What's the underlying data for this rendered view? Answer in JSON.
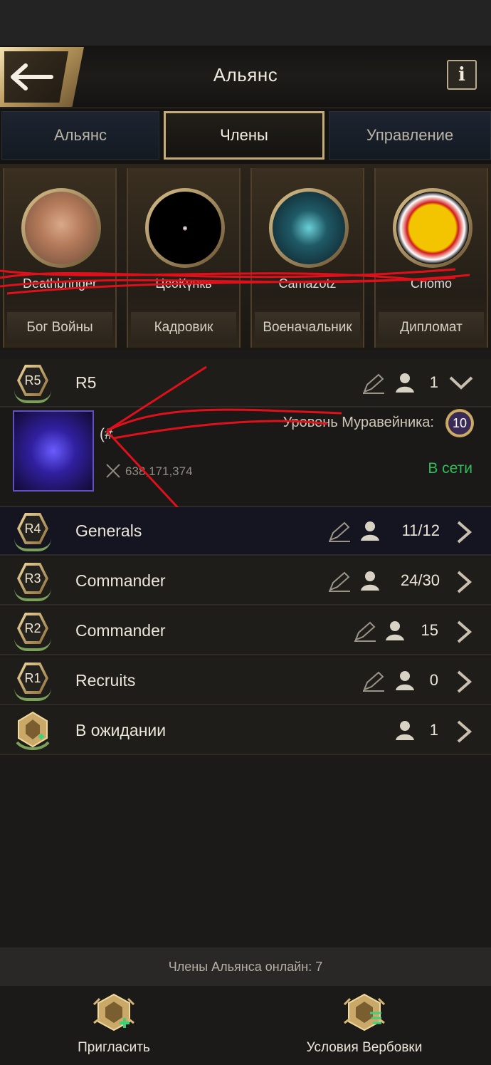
{
  "header": {
    "title": "Альянс"
  },
  "tabs": [
    {
      "label": "Альянс",
      "active": false
    },
    {
      "label": "Члены",
      "active": true
    },
    {
      "label": "Управление",
      "active": false
    }
  ],
  "leaders": [
    {
      "name": "Deathbringer",
      "role": "Бог Войны"
    },
    {
      "name": "ЦсоКүнкь",
      "role": "Кадровик"
    },
    {
      "name": "Camazotz",
      "role": "Военачальник"
    },
    {
      "name": "Chomo",
      "role": "Дипломат"
    }
  ],
  "ranks": [
    {
      "badge": "R5",
      "label": "R5",
      "count": "1",
      "expanded": true
    },
    {
      "badge": "R4",
      "label": "Generals",
      "count": "11/12"
    },
    {
      "badge": "R3",
      "label": "Commander",
      "count": "24/30"
    },
    {
      "badge": "R2",
      "label": "Commander",
      "count": "15"
    },
    {
      "badge": "R1",
      "label": "Recruits",
      "count": "0"
    },
    {
      "badge": "",
      "label": "В ожидании",
      "count": "1"
    }
  ],
  "member": {
    "name": "(#",
    "power": "638,171,374",
    "level_label": "Уровень Муравейника:",
    "level": "10",
    "status": "В сети"
  },
  "footer": {
    "online_text": "Члены Альянса онлайн: 7",
    "invite_label": "Пригласить",
    "recruit_label": "Условия Вербовки"
  },
  "colors": {
    "gold": "#c4ab78",
    "online": "#2fbf5a",
    "edit_stroke": "#9a9386"
  }
}
